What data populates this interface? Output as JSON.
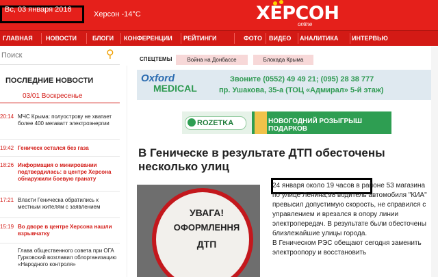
{
  "header": {
    "date": "Вс, 03 января 2016",
    "weather": "Херсон -14°C",
    "logo": "ХЕРСОН",
    "logo_sub": "online"
  },
  "nav": [
    "ГЛАВНАЯ",
    "НОВОСТИ",
    "БЛОГИ",
    "КОНФЕРЕНЦИИ",
    "РЕЙТИНГИ",
    "ФОТО",
    "ВИДЕО",
    "АНАЛИТИКА",
    "ИНТЕРВЬЮ"
  ],
  "search": {
    "placeholder": "Поиск"
  },
  "sidebar": {
    "heading": "ПОСЛЕДНИЕ НОВОСТИ",
    "date": "03/01 Воскресенье",
    "items": [
      {
        "time": "20:14",
        "text": "МЧС Крыма: полуострову не хватает более 400 мегаватт электроэнергии"
      },
      {
        "time": "19:42",
        "text": "Геническ остался без газа"
      },
      {
        "time": "18:26",
        "text": "Информация о минировании подтвердилась: в центре Херсона обнаружили боевую гранату"
      },
      {
        "time": "17:21",
        "text": "Власти Геническа обратились к местным жителям с заявлением"
      },
      {
        "time": "15:19",
        "text": "Во дворе в центре Херсона нашли взрывчатку"
      },
      {
        "time": "",
        "text": "Глава общественного совета при ОГА Гурковский возглавил облорганизацию «Народного контроля»"
      }
    ]
  },
  "specthemes": {
    "label": "СПЕЦТЕМЫ",
    "tabs": [
      "Война на Донбассе",
      "Блокада Крыма"
    ]
  },
  "banner1": {
    "logo_top": "Oxford",
    "logo_bottom": "MEDICAL",
    "phone": "Звоните (0552) 49 49 21; (095) 28 38 777",
    "address": "пр. Ушакова, 35-а (ТОЦ «Адмирал» 5-й этаж)"
  },
  "banner2": {
    "brand": "ROZETKA",
    "text": "НОВОГОДНИЙ РОЗЫГРЫШ ПОДАРКОВ"
  },
  "article": {
    "title": "В Геническе в результате ДТП обесточены несколько улиц",
    "sign_line1": "УВАГА!",
    "sign_line2": "ОФОРМЛЕННЯ",
    "sign_line3": "ДТП",
    "p1": "24 января около 19 часов в районе 53 магазина по улице Ленина,98 водитель автомобиля \"КИА\" превысил допустимую скорость, не справился с управлением и врезался в опору линии электропередач. В результате были обесточены близлежайшие улицы города.",
    "p2": "В Геническом РЭС обещают сегодня заменить электроопору и восстановить"
  }
}
